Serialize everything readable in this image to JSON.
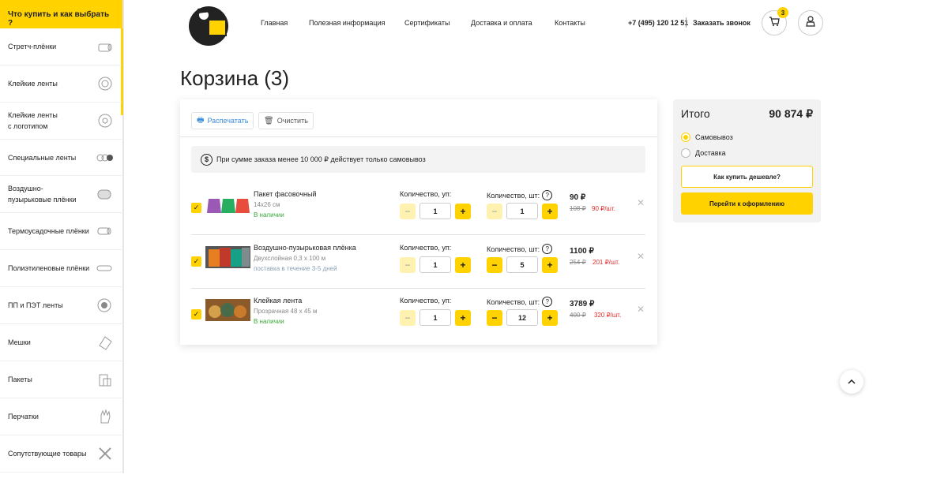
{
  "sidebar": {
    "header": "Что купить и как выбрать ?",
    "items": [
      {
        "label": "Стретч-плёнки",
        "icon": "stretch-film-icon"
      },
      {
        "label": "Клейкие ленты",
        "icon": "tape-roll-icon"
      },
      {
        "label": "Клейкие ленты\nс логотипом",
        "icon": "logo-tape-icon"
      },
      {
        "label": "Специальные ленты",
        "icon": "special-tape-icon"
      },
      {
        "label": "Воздушно-\nпузырьковые плёнки",
        "icon": "bubble-wrap-icon"
      },
      {
        "label": "Термоусадочные плёнки",
        "icon": "shrink-film-icon"
      },
      {
        "label": "Полиэтиленовые плёнки",
        "icon": "pe-film-icon"
      },
      {
        "label": "ПП и ПЭТ ленты",
        "icon": "strap-roll-icon"
      },
      {
        "label": "Мешки",
        "icon": "sack-icon"
      },
      {
        "label": "Пакеты",
        "icon": "bag-icon"
      },
      {
        "label": "Перчатки",
        "icon": "glove-icon"
      },
      {
        "label": "Сопутствующие товары",
        "icon": "tools-icon"
      }
    ]
  },
  "header": {
    "nav": [
      "Главная",
      "Полезная информация",
      "Сертификаты",
      "Доставка и оплата",
      "Контакты"
    ],
    "phone": "+7 (495) 120 12 51",
    "callback": "Заказать звонок",
    "cart_count": "3"
  },
  "page": {
    "title": "Корзина (3)",
    "print_label": "Распечатать",
    "clear_label": "Очистить",
    "notice": "При сумме заказа менее 10 000 ₽ действует только самовывоз",
    "qty_pack_label": "Количество, уп:",
    "qty_pcs_label": "Количество, шт:"
  },
  "cart_items": [
    {
      "name": "Пакет фасовочный",
      "sub": "14x26 см",
      "status": "В наличии",
      "status_color": "#3aa83a",
      "qty_pack": "1",
      "qty_pcs": "1",
      "price": "90 ₽",
      "old_price": "108 ₽",
      "unit_price": "90 ₽/шт."
    },
    {
      "name": "Воздушно-пузырьковая плёнка",
      "sub": "Двухслойная 0,3 х 100 м",
      "status": "поставка в течение 3-5 дней",
      "status_color": "#8aa0b3",
      "qty_pack": "1",
      "qty_pcs": "5",
      "price": "1100 ₽",
      "old_price": "254 ₽",
      "unit_price": "201 ₽/шт."
    },
    {
      "name": "Клейкая лента",
      "sub": "Прозрачная 48 х 45 м",
      "status": "В наличии",
      "status_color": "#3aa83a",
      "qty_pack": "1",
      "qty_pcs": "12",
      "price": "3789 ₽",
      "old_price": "400 ₽",
      "unit_price": "320 ₽/шт."
    }
  ],
  "summary": {
    "title": "Итого",
    "total": "90 874 ₽",
    "delivery_options": [
      "Самовывоз",
      "Доставка"
    ],
    "selected_option": "Самовывоз",
    "cheaper_button": "Как купить дешевле?",
    "checkout_button": "Перейти к оформлению"
  },
  "colors": {
    "accent": "#ffd200",
    "discount": "#e62b2b",
    "in_stock": "#3aa83a"
  }
}
